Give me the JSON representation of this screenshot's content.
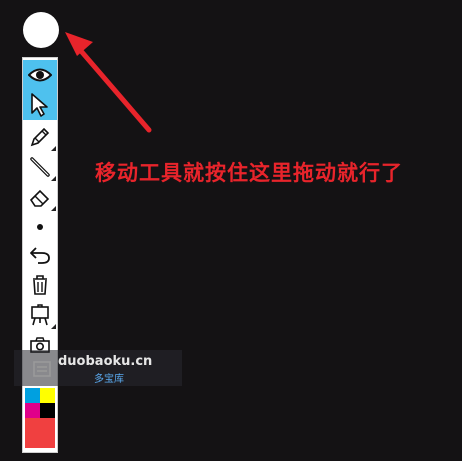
{
  "annotation": {
    "text": "移动工具就按住这里拖动就行了",
    "color": "#e8242b"
  },
  "toolbar": {
    "tools": [
      {
        "icon": "eye-icon",
        "active": true
      },
      {
        "icon": "arrow-cursor-icon",
        "active": true
      },
      {
        "icon": "pencil-icon",
        "active": false
      },
      {
        "icon": "line-icon",
        "active": false
      },
      {
        "icon": "eraser-icon",
        "active": false
      },
      {
        "icon": "brush-size-dot-icon",
        "active": false
      },
      {
        "icon": "undo-icon",
        "active": false
      },
      {
        "icon": "trash-icon",
        "active": false
      },
      {
        "icon": "easel-icon",
        "active": false
      },
      {
        "icon": "camera-icon",
        "active": false
      }
    ],
    "active_color": "#4ec1ee",
    "palette": [
      "#00a0e0",
      "#ffff00",
      "#e0008a",
      "#000000",
      "#f04040"
    ]
  },
  "watermark": {
    "site": "duobaoku.cn",
    "name": "多宝库"
  }
}
